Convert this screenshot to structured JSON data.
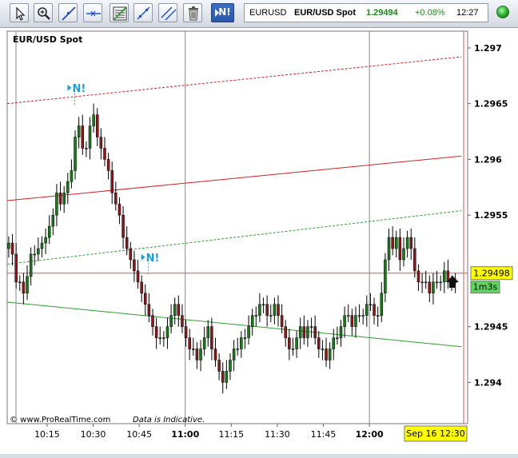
{
  "toolbar": {
    "tools": [
      {
        "name": "pointer-tool",
        "icon": "pointer-icon"
      },
      {
        "name": "zoom-tool",
        "icon": "zoom-icon"
      },
      {
        "name": "line-tool",
        "icon": "trendline-icon"
      },
      {
        "name": "horizontal-line-tool",
        "icon": "horizontal-line-icon"
      },
      {
        "name": "fibonacci-tool",
        "icon": "fibonacci-icon"
      },
      {
        "name": "channel-tool",
        "icon": "channel-icon"
      },
      {
        "name": "parallel-lines-tool",
        "icon": "parallel-lines-icon"
      },
      {
        "name": "delete-tool",
        "icon": "trash-icon"
      }
    ],
    "n_button_label": "N!"
  },
  "quote": {
    "symbol": "EURUSD",
    "name": "EUR/USD Spot",
    "price": "1.29494",
    "change": "+0.08%",
    "time": "12:27",
    "price_color": "#1a8a1a"
  },
  "chart": {
    "title": "EUR/USD Spot",
    "footer_copyright": "© www.ProRealTime.com",
    "footer_note": "Data is Indicative.",
    "current_price_label": "1.29498",
    "countdown_label": "1m3s",
    "cursor_date_label": "Sep 16 12:30",
    "news_marker_label": "N!",
    "colors": {
      "up": "#1a7a1a",
      "down": "#8a1a1a",
      "resistance": "#d42020",
      "support": "#2aa02a",
      "price_line": "#e05050",
      "label_bg": "#ffff00",
      "countdown_bg": "#5fd45f"
    }
  },
  "chart_data": {
    "type": "candlestick",
    "title": "EUR/USD Spot",
    "x_tick_labels": [
      "10:15",
      "10:30",
      "10:45",
      "11:00",
      "11:15",
      "11:30",
      "11:45",
      "12:00"
    ],
    "x_tick_times": [
      "10:15",
      "10:30",
      "10:45",
      "11:00",
      "11:15",
      "11:30",
      "11:45",
      "12:00"
    ],
    "bold_x_ticks": [
      "11:00",
      "12:00"
    ],
    "y_tick_labels": [
      "1.297",
      "1.2965",
      "1.296",
      "1.2955",
      "1.2945",
      "1.294"
    ],
    "y_ticks": [
      1.297,
      1.2965,
      1.296,
      1.2955,
      1.2945,
      1.294
    ],
    "ylim": [
      1.29363,
      1.29715
    ],
    "xlim": [
      "10:02",
      "12:32"
    ],
    "last_price": 1.29498,
    "news_markers": [
      {
        "time": "10:24",
        "price": 1.29657
      },
      {
        "time": "10:48",
        "price": 1.29505
      }
    ],
    "trend_lines": [
      {
        "style": "dashed",
        "color": "#d42020",
        "from": {
          "time": "10:02",
          "price": 1.2965
        },
        "to": {
          "time": "12:30",
          "price": 1.29692
        }
      },
      {
        "style": "solid",
        "color": "#d42020",
        "from": {
          "time": "10:02",
          "price": 1.29563
        },
        "to": {
          "time": "12:30",
          "price": 1.29603
        }
      },
      {
        "style": "dashed",
        "color": "#2aa02a",
        "from": {
          "time": "10:02",
          "price": 1.29506
        },
        "to": {
          "time": "12:30",
          "price": 1.29554
        }
      },
      {
        "style": "solid",
        "color": "#2aa02a",
        "from": {
          "time": "10:02",
          "price": 1.29472
        },
        "to": {
          "time": "12:30",
          "price": 1.29432
        }
      }
    ],
    "candle_closes": [
      1.29525,
      1.29515,
      1.2949,
      1.2949,
      1.2948,
      1.29495,
      1.29515,
      1.29515,
      1.2952,
      1.29525,
      1.2953,
      1.2954,
      1.2955,
      1.2957,
      1.2956,
      1.2957,
      1.2958,
      1.2959,
      1.2962,
      1.2963,
      1.2961,
      1.2961,
      1.2963,
      1.2964,
      1.2962,
      1.2961,
      1.296,
      1.2959,
      1.2957,
      1.2956,
      1.2955,
      1.2953,
      1.2952,
      1.2951,
      1.295,
      1.2949,
      1.2948,
      1.2947,
      1.2946,
      1.2945,
      1.2944,
      1.2944,
      1.2944,
      1.2945,
      1.2946,
      1.2947,
      1.2946,
      1.2945,
      1.2944,
      1.2943,
      1.2943,
      1.2942,
      1.2943,
      1.2944,
      1.2945,
      1.2943,
      1.2942,
      1.2941,
      1.294,
      1.2941,
      1.2942,
      1.2943,
      1.2943,
      1.2944,
      1.2944,
      1.2945,
      1.2946,
      1.2946,
      1.2947,
      1.2947,
      1.2946,
      1.2946,
      1.2947,
      1.2946,
      1.2945,
      1.2944,
      1.2943,
      1.2943,
      1.2944,
      1.2945,
      1.2944,
      1.2945,
      1.2945,
      1.2944,
      1.2943,
      1.2943,
      1.2942,
      1.2943,
      1.2944,
      1.2944,
      1.2945,
      1.2946,
      1.2946,
      1.2945,
      1.2946,
      1.2946,
      1.2946,
      1.2947,
      1.2947,
      1.2946,
      1.2946,
      1.2948,
      1.2951,
      1.2953,
      1.2952,
      1.2953,
      1.2951,
      1.2952,
      1.2953,
      1.2952,
      1.295,
      1.2949,
      1.2949,
      1.2949,
      1.2948,
      1.2949,
      1.2949,
      1.2949,
      1.295,
      1.2949,
      1.2949,
      1.2949
    ]
  }
}
